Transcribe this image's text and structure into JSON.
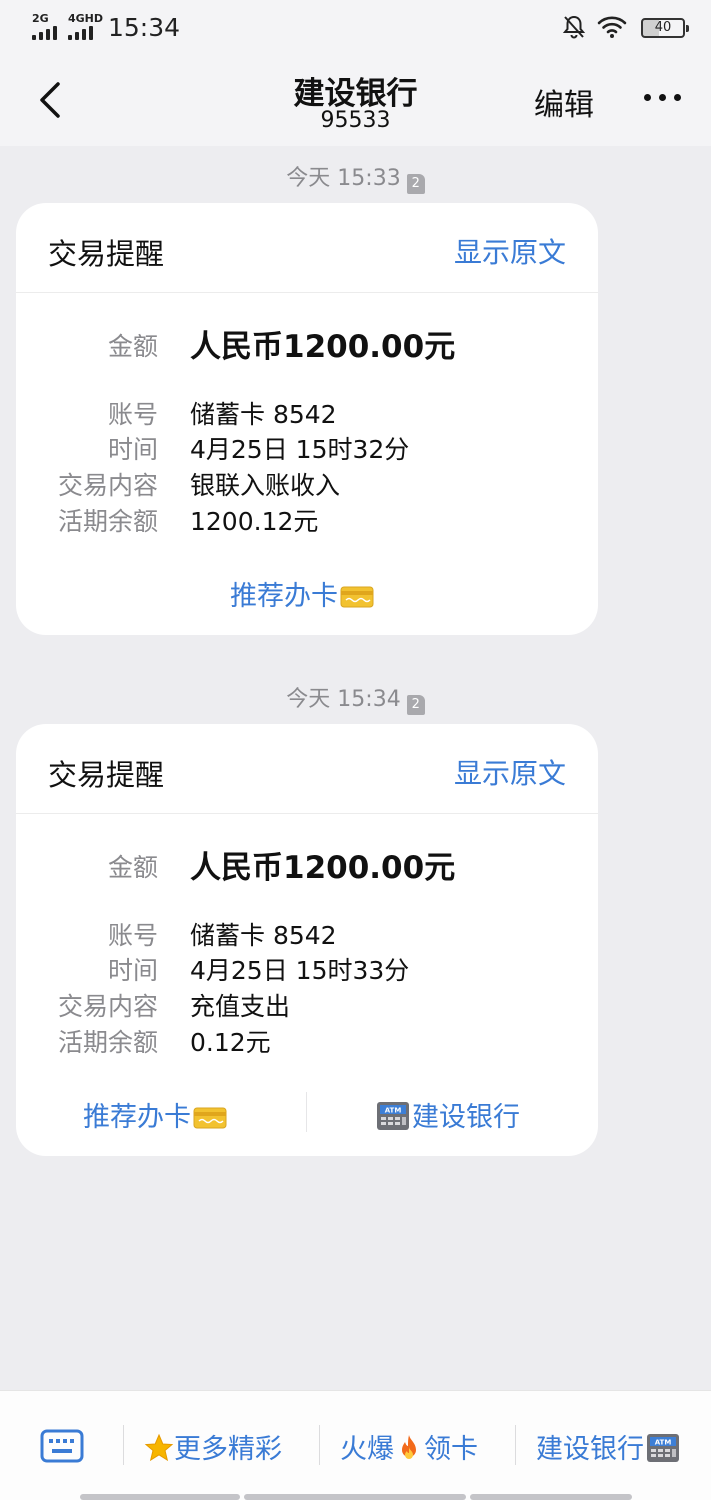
{
  "status_bar": {
    "net1": "2G",
    "net2": "4GHD",
    "time": "15:34",
    "battery": "40"
  },
  "header": {
    "title": "建设银行",
    "subtitle": "95533",
    "edit_label": "编辑"
  },
  "messages": [
    {
      "timestamp": "今天 15:33",
      "sim": "2",
      "card_title": "交易提醒",
      "show_original": "显示原文",
      "amount_label": "金额",
      "amount_value": "人民币1200.00元",
      "account_label": "账号",
      "account_value": "储蓄卡 8542",
      "time_label": "时间",
      "time_value": "4月25日 15时32分",
      "content_label": "交易内容",
      "content_value": "银联入账收入",
      "balance_label": "活期余额",
      "balance_value": "1200.12元",
      "links": [
        "推荐办卡"
      ]
    },
    {
      "timestamp": "今天 15:34",
      "sim": "2",
      "card_title": "交易提醒",
      "show_original": "显示原文",
      "amount_label": "金额",
      "amount_value": "人民币1200.00元",
      "account_label": "账号",
      "account_value": "储蓄卡 8542",
      "time_label": "时间",
      "time_value": "4月25日 15时33分",
      "content_label": "交易内容",
      "content_value": "充值支出",
      "balance_label": "活期余额",
      "balance_value": "0.12元",
      "links": [
        "推荐办卡",
        "建设银行"
      ]
    }
  ],
  "bottom_menu": {
    "items": [
      "更多精彩",
      "火爆",
      "领卡",
      "建设银行"
    ]
  },
  "colors": {
    "accent": "#3a7bd5",
    "background": "#ededf0",
    "card": "#ffffff",
    "muted": "#8a8a8e"
  },
  "icons": [
    "back-arrow-icon",
    "more-icon",
    "bell-off-icon",
    "wifi-icon",
    "bank-card-icon",
    "atm-icon",
    "keyboard-icon",
    "star-icon",
    "fire-icon"
  ]
}
